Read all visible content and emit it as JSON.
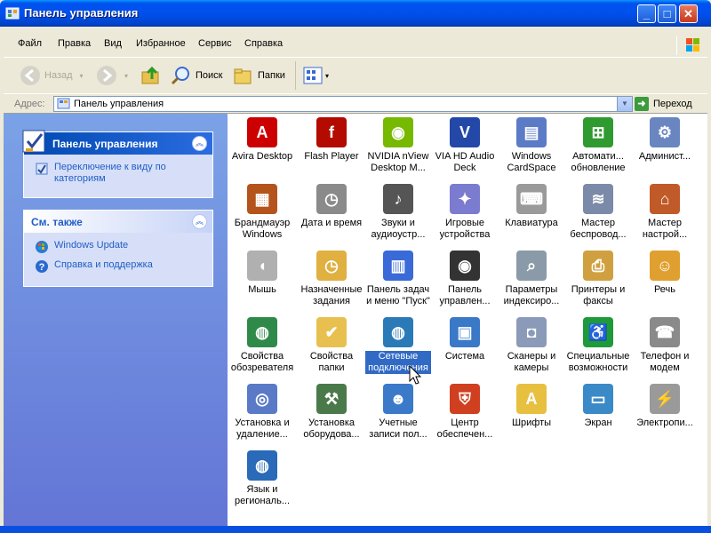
{
  "window": {
    "title": "Панель управления"
  },
  "menu": [
    "Файл",
    "Правка",
    "Вид",
    "Избранное",
    "Сервис",
    "Справка"
  ],
  "toolbar": {
    "back": "Назад",
    "search": "Поиск",
    "folders": "Папки"
  },
  "address": {
    "label": "Адрес:",
    "value": "Панель управления",
    "go": "Переход"
  },
  "tasks": {
    "control_panel": {
      "title": "Панель управления",
      "link": "Переключение к виду по категориям"
    },
    "see_also": {
      "title": "См. также",
      "links": [
        "Windows Update",
        "Справка и поддержка"
      ]
    }
  },
  "items": [
    {
      "label": "Avira Desktop",
      "icon": "avira-icon",
      "color": "#cc0000",
      "glyph": "A"
    },
    {
      "label": "Flash Player",
      "icon": "flash-icon",
      "color": "#b30b00",
      "glyph": "f"
    },
    {
      "label": "NVIDIA nView Desktop M...",
      "icon": "nvidia-icon",
      "color": "#76b900",
      "glyph": "◉"
    },
    {
      "label": "VIA HD Audio Deck",
      "icon": "via-audio-icon",
      "color": "#2448a8",
      "glyph": "V"
    },
    {
      "label": "Windows CardSpace",
      "icon": "cardspace-icon",
      "color": "#5b7bc7",
      "glyph": "▤"
    },
    {
      "label": "Автомати... обновление",
      "icon": "windows-update-icon",
      "color": "#2f9a2f",
      "glyph": "⊞"
    },
    {
      "label": "Админист...",
      "icon": "admin-tools-icon",
      "color": "#6a86c0",
      "glyph": "⚙"
    },
    {
      "label": "Брандмауэр Windows",
      "icon": "firewall-icon",
      "color": "#b5531c",
      "glyph": "▦"
    },
    {
      "label": "Дата и время",
      "icon": "datetime-icon",
      "color": "#8a8a8a",
      "glyph": "◷"
    },
    {
      "label": "Звуки и аудиоустр...",
      "icon": "sounds-icon",
      "color": "#555555",
      "glyph": "♪"
    },
    {
      "label": "Игровые устройства",
      "icon": "gamepad-icon",
      "color": "#7b7bd0",
      "glyph": "✦"
    },
    {
      "label": "Клавиатура",
      "icon": "keyboard-icon",
      "color": "#9a9a9a",
      "glyph": "⌨"
    },
    {
      "label": "Мастер беспровод...",
      "icon": "wireless-icon",
      "color": "#7a8aa8",
      "glyph": "≋"
    },
    {
      "label": "Мастер настрой...",
      "icon": "network-setup-icon",
      "color": "#c05a28",
      "glyph": "⌂"
    },
    {
      "label": "Мышь",
      "icon": "mouse-icon",
      "color": "#b0b0b0",
      "glyph": "◖"
    },
    {
      "label": "Назначенные задания",
      "icon": "scheduled-tasks-icon",
      "color": "#e0b040",
      "glyph": "◷"
    },
    {
      "label": "Панель задач и меню \"Пуск\"",
      "icon": "taskbar-icon",
      "color": "#3a6ad8",
      "glyph": "▥"
    },
    {
      "label": "Панель управлен...",
      "icon": "nvidia-panel-icon",
      "color": "#333333",
      "glyph": "◉"
    },
    {
      "label": "Параметры индексиро...",
      "icon": "indexing-icon",
      "color": "#8a9aa8",
      "glyph": "⌕"
    },
    {
      "label": "Принтеры и факсы",
      "icon": "printer-icon",
      "color": "#d0a040",
      "glyph": "⎙"
    },
    {
      "label": "Речь",
      "icon": "speech-icon",
      "color": "#e0a030",
      "glyph": "☺"
    },
    {
      "label": "Свойства обозревателя",
      "icon": "internet-options-icon",
      "color": "#2f8a4a",
      "glyph": "◍"
    },
    {
      "label": "Свойства папки",
      "icon": "folder-options-icon",
      "color": "#e8c050",
      "glyph": "✔"
    },
    {
      "label": "Сетевые подключения",
      "icon": "network-connections-icon",
      "color": "#2a7ab8",
      "glyph": "◍"
    },
    {
      "label": "Система",
      "icon": "system-icon",
      "color": "#3a78c8",
      "glyph": "▣"
    },
    {
      "label": "Сканеры и камеры",
      "icon": "scanner-icon",
      "color": "#8a9ab8",
      "glyph": "◘"
    },
    {
      "label": "Специальные возможности",
      "icon": "accessibility-icon",
      "color": "#1f9a3a",
      "glyph": "♿"
    },
    {
      "label": "Телефон и модем",
      "icon": "phone-modem-icon",
      "color": "#8a8a8a",
      "glyph": "☎"
    },
    {
      "label": "Установка и удаление...",
      "icon": "add-remove-icon",
      "color": "#5a7ac8",
      "glyph": "◎"
    },
    {
      "label": "Установка оборудова...",
      "icon": "add-hardware-icon",
      "color": "#4a7a4a",
      "glyph": "⚒"
    },
    {
      "label": "Учетные записи пол...",
      "icon": "user-accounts-icon",
      "color": "#3a7ac8",
      "glyph": "☻"
    },
    {
      "label": "Центр обеспечен...",
      "icon": "security-center-icon",
      "color": "#d04020",
      "glyph": "⛨"
    },
    {
      "label": "Шрифты",
      "icon": "fonts-icon",
      "color": "#e8c040",
      "glyph": "A"
    },
    {
      "label": "Экран",
      "icon": "display-icon",
      "color": "#3a8ac8",
      "glyph": "▭"
    },
    {
      "label": "Электропи...",
      "icon": "power-icon",
      "color": "#9a9a9a",
      "glyph": "⚡"
    },
    {
      "label": "Язык и региональ...",
      "icon": "regional-icon",
      "color": "#2a6ab8",
      "glyph": "◍"
    }
  ],
  "selected_item": "Сетевые подключения"
}
